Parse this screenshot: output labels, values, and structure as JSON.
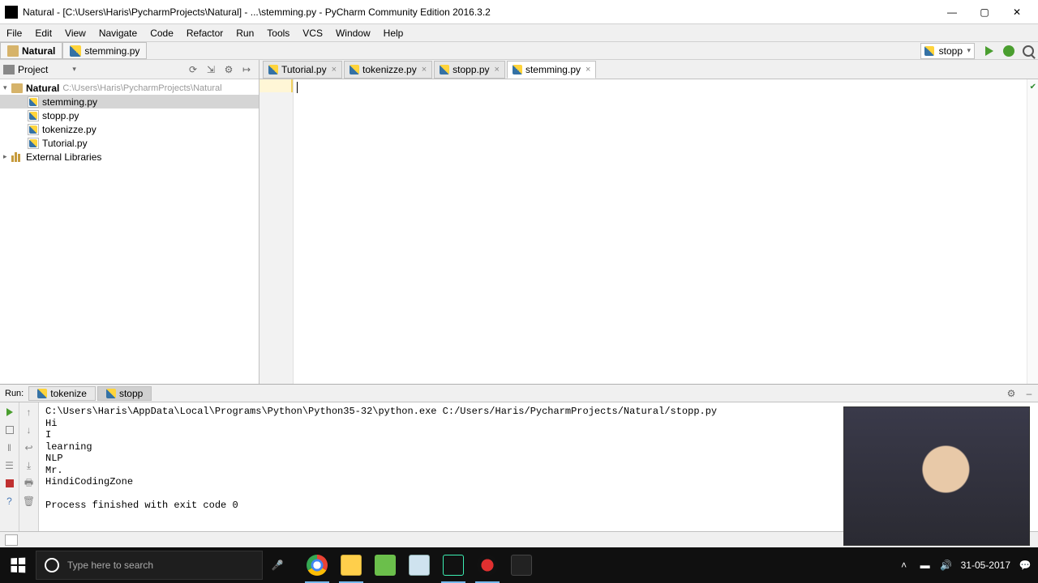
{
  "titlebar": {
    "text": "Natural - [C:\\Users\\Haris\\PycharmProjects\\Natural] - ...\\stemming.py - PyCharm Community Edition 2016.3.2"
  },
  "menu": {
    "items": [
      "File",
      "Edit",
      "View",
      "Navigate",
      "Code",
      "Refactor",
      "Run",
      "Tools",
      "VCS",
      "Window",
      "Help"
    ]
  },
  "breadcrumb": {
    "project": "Natural",
    "file": "stemming.py"
  },
  "run_config": {
    "selected": "stopp"
  },
  "project_tool": {
    "title": "Project",
    "root": {
      "name": "Natural",
      "path": "C:\\Users\\Haris\\PycharmProjects\\Natural"
    },
    "files": [
      {
        "name": "stemming.py",
        "selected": true
      },
      {
        "name": "stopp.py",
        "selected": false
      },
      {
        "name": "tokenizze.py",
        "selected": false
      },
      {
        "name": "Tutorial.py",
        "selected": false
      }
    ],
    "external_libs": "External Libraries"
  },
  "editor": {
    "tabs": [
      {
        "label": "Tutorial.py",
        "active": false
      },
      {
        "label": "tokenizze.py",
        "active": false
      },
      {
        "label": "stopp.py",
        "active": false
      },
      {
        "label": "stemming.py",
        "active": true
      }
    ]
  },
  "run_panel": {
    "label": "Run:",
    "tabs": [
      {
        "label": "tokenize",
        "active": false
      },
      {
        "label": "stopp",
        "active": true
      }
    ],
    "console": "C:\\Users\\Haris\\AppData\\Local\\Programs\\Python\\Python35-32\\python.exe C:/Users/Haris/PycharmProjects/Natural/stopp.py\nHi\nI\nlearning\nNLP\nMr.\nHindiCodingZone\n\nProcess finished with exit code 0"
  },
  "taskbar": {
    "search_placeholder": "Type here to search",
    "time": "",
    "date": "31-05-2017"
  }
}
